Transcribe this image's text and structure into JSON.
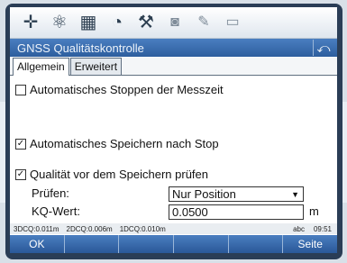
{
  "toolbar": {
    "icons": [
      "crosshair-icon",
      "satellite-icon",
      "keypad-icon",
      "globe-icon",
      "tools-icon",
      "camera-icon",
      "notes-icon",
      "window-icon"
    ]
  },
  "window": {
    "title": "GNSS Qualitätskontrolle"
  },
  "tabs": [
    {
      "label": "Allgemein",
      "active": true
    },
    {
      "label": "Erweitert",
      "active": false
    }
  ],
  "options": {
    "auto_stop": {
      "label": "Automatisches Stoppen der Messzeit",
      "checked": false
    },
    "auto_save": {
      "label": "Automatisches Speichern nach Stop",
      "checked": true
    },
    "quality_check": {
      "label": "Qualität vor dem Speichern prüfen",
      "checked": true
    }
  },
  "fields": {
    "pruefen": {
      "label": "Prüfen:",
      "value": "Nur Position"
    },
    "kq_wert": {
      "label": "KQ-Wert:",
      "value": "0.0500",
      "unit": "m"
    }
  },
  "status": {
    "cq3d": "3DCQ:0.011m",
    "cq2d": "2DCQ:0.006m",
    "cq1d": "1DCQ:0.010m",
    "input_mode": "abc",
    "time": "09:51"
  },
  "softkeys": [
    "OK",
    "",
    "",
    "",
    "",
    "Seite"
  ]
}
